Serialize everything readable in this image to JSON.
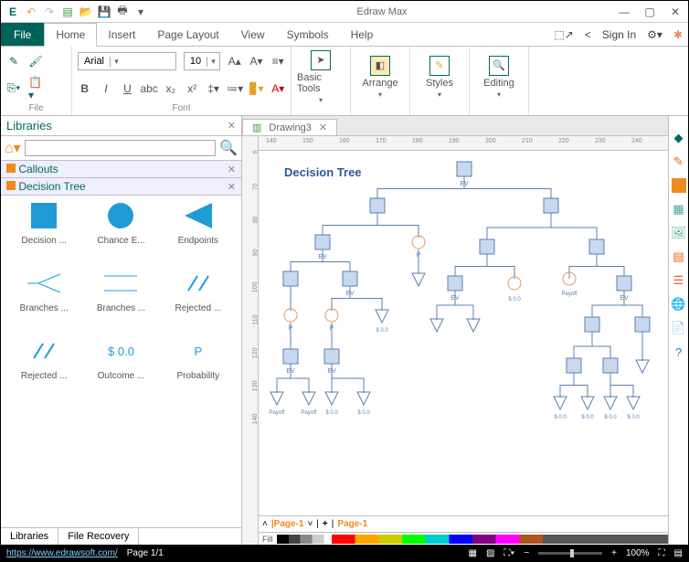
{
  "app": {
    "title": "Edraw Max"
  },
  "window": {
    "min": "—",
    "max": "▢",
    "close": "✕"
  },
  "menu": {
    "file": "File",
    "tabs": [
      "Home",
      "Insert",
      "Page Layout",
      "View",
      "Symbols",
      "Help"
    ],
    "signin": "Sign In"
  },
  "ribbon": {
    "file_group": "File",
    "font_group": "Font",
    "font_name": "Arial",
    "font_size": "10",
    "basic_tools": "Basic Tools",
    "arrange": "Arrange",
    "styles": "Styles",
    "editing": "Editing",
    "bold": "B",
    "italic": "I",
    "underline": "U"
  },
  "libraries": {
    "title": "Libraries",
    "callouts": "Callouts",
    "decision_tree": "Decision Tree",
    "shapes": [
      {
        "name": "Decision ...",
        "t": "square"
      },
      {
        "name": "Chance E...",
        "t": "circle"
      },
      {
        "name": "Endpoints",
        "t": "tri"
      },
      {
        "name": "Branches ...",
        "t": "branch1"
      },
      {
        "name": "Branches ...",
        "t": "branch2"
      },
      {
        "name": "Rejected ...",
        "t": "slash"
      },
      {
        "name": "Rejected ...",
        "t": "slash"
      },
      {
        "name": "Outcome ...",
        "t": "txt",
        "txt": "$ 0.0"
      },
      {
        "name": "Probability",
        "t": "txt",
        "txt": "P"
      }
    ],
    "tab_lib": "Libraries",
    "tab_rec": "File Recovery"
  },
  "doc": {
    "tab": "Drawing3",
    "canvas_title": "Decision Tree"
  },
  "ruler_h": [
    "140",
    "150",
    "160",
    "170",
    "180",
    "190",
    "200",
    "210",
    "220",
    "230",
    "240"
  ],
  "ruler_v": [
    "6",
    "70",
    "80",
    "90",
    "100",
    "110",
    "120",
    "130",
    "140"
  ],
  "pages": {
    "p1": "Page-1",
    "p2": "Page-1",
    "fill": "Fill"
  },
  "status": {
    "url": "https://www.edrawsoft.com/",
    "page": "Page 1/1",
    "zoom": "100%",
    "minus": "−",
    "plus": "+"
  },
  "tree_labels": {
    "ev": "EV",
    "p": "P",
    "payoff": "Payoff",
    "cost": "$ 0.0"
  }
}
